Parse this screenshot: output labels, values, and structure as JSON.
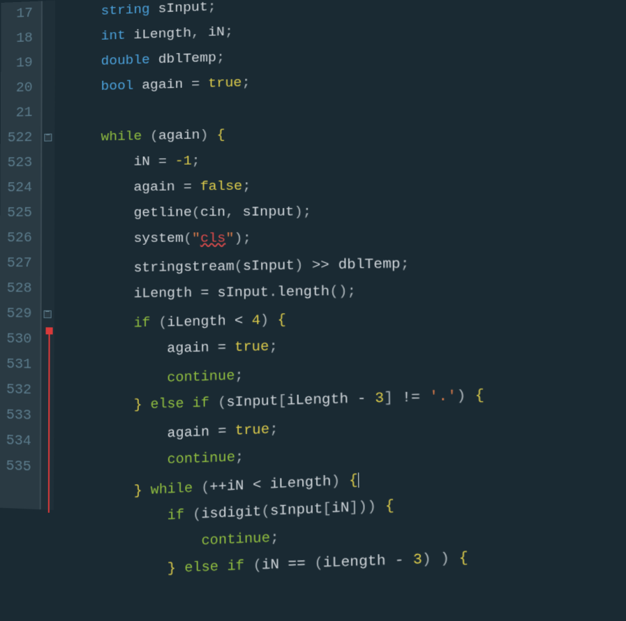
{
  "gutter": {
    "start": 16,
    "end": 535,
    "visible": [
      "17",
      "18",
      "19",
      "20",
      "21",
      "22",
      "23",
      "24",
      "25",
      "26",
      "27",
      "28",
      "29",
      "30",
      "31",
      "32",
      "33",
      "34",
      "35"
    ],
    "prefix_5": [
      "",
      "",
      "",
      "",
      "",
      "5",
      "5",
      "5",
      "5",
      "5",
      "5",
      "5",
      "5",
      "5",
      "5",
      "5",
      "5",
      "5",
      "5"
    ]
  },
  "fold": {
    "positions": [
      5,
      12
    ]
  },
  "code": {
    "lines": [
      {
        "indent": 2,
        "t": [
          [
            "type",
            "string"
          ],
          [
            "sp",
            " "
          ],
          [
            "ident",
            "sInput"
          ],
          [
            "punct",
            ";"
          ]
        ]
      },
      {
        "indent": 2,
        "t": [
          [
            "type",
            "int"
          ],
          [
            "sp",
            " "
          ],
          [
            "ident",
            "iLength"
          ],
          [
            "punct",
            ", "
          ],
          [
            "ident",
            "iN"
          ],
          [
            "punct",
            ";"
          ]
        ]
      },
      {
        "indent": 2,
        "t": [
          [
            "type",
            "double"
          ],
          [
            "sp",
            " "
          ],
          [
            "ident",
            "dblTemp"
          ],
          [
            "punct",
            ";"
          ]
        ]
      },
      {
        "indent": 2,
        "t": [
          [
            "type",
            "bool"
          ],
          [
            "sp",
            " "
          ],
          [
            "ident",
            "again"
          ],
          [
            "op",
            " = "
          ],
          [
            "bool",
            "true"
          ],
          [
            "punct",
            ";"
          ]
        ]
      },
      {
        "indent": 0,
        "t": []
      },
      {
        "indent": 2,
        "t": [
          [
            "kw",
            "while"
          ],
          [
            "sp",
            " "
          ],
          [
            "punct",
            "("
          ],
          [
            "ident",
            "again"
          ],
          [
            "punct",
            ") "
          ],
          [
            "bracket",
            "{"
          ]
        ]
      },
      {
        "indent": 4,
        "t": [
          [
            "ident",
            "iN"
          ],
          [
            "op",
            " = "
          ],
          [
            "num",
            "-1"
          ],
          [
            "punct",
            ";"
          ]
        ]
      },
      {
        "indent": 4,
        "t": [
          [
            "ident",
            "again"
          ],
          [
            "op",
            " = "
          ],
          [
            "bool",
            "false"
          ],
          [
            "punct",
            ";"
          ]
        ]
      },
      {
        "indent": 4,
        "t": [
          [
            "func",
            "getline"
          ],
          [
            "punct",
            "("
          ],
          [
            "ident",
            "cin"
          ],
          [
            "punct",
            ", "
          ],
          [
            "ident",
            "sInput"
          ],
          [
            "punct",
            ");"
          ]
        ]
      },
      {
        "indent": 4,
        "t": [
          [
            "func",
            "system"
          ],
          [
            "punct",
            "("
          ],
          [
            "str",
            "\""
          ],
          [
            "str-err",
            "cls"
          ],
          [
            "str",
            "\""
          ],
          [
            "punct",
            ");"
          ]
        ]
      },
      {
        "indent": 4,
        "t": [
          [
            "func",
            "stringstream"
          ],
          [
            "punct",
            "("
          ],
          [
            "ident",
            "sInput"
          ],
          [
            "punct",
            ") "
          ],
          [
            "op",
            ">> "
          ],
          [
            "ident",
            "dblTemp"
          ],
          [
            "punct",
            ";"
          ]
        ]
      },
      {
        "indent": 4,
        "t": [
          [
            "ident",
            "iLength"
          ],
          [
            "op",
            " = "
          ],
          [
            "ident",
            "sInput"
          ],
          [
            "punct",
            "."
          ],
          [
            "func",
            "length"
          ],
          [
            "punct",
            "();"
          ]
        ]
      },
      {
        "indent": 4,
        "t": [
          [
            "kw",
            "if"
          ],
          [
            "sp",
            " "
          ],
          [
            "punct",
            "("
          ],
          [
            "ident",
            "iLength"
          ],
          [
            "op",
            " < "
          ],
          [
            "num",
            "4"
          ],
          [
            "punct",
            ") "
          ],
          [
            "bracket",
            "{"
          ]
        ]
      },
      {
        "indent": 6,
        "t": [
          [
            "ident",
            "again"
          ],
          [
            "op",
            " = "
          ],
          [
            "bool",
            "true"
          ],
          [
            "punct",
            ";"
          ]
        ]
      },
      {
        "indent": 6,
        "t": [
          [
            "kw",
            "continue"
          ],
          [
            "punct",
            ";"
          ]
        ]
      },
      {
        "indent": 4,
        "t": [
          [
            "bracket",
            "}"
          ],
          [
            "sp",
            " "
          ],
          [
            "kw",
            "else if"
          ],
          [
            "sp",
            " "
          ],
          [
            "punct",
            "("
          ],
          [
            "ident",
            "sInput"
          ],
          [
            "punct",
            "["
          ],
          [
            "ident",
            "iLength"
          ],
          [
            "op",
            " - "
          ],
          [
            "num",
            "3"
          ],
          [
            "punct",
            "] "
          ],
          [
            "op",
            "!= "
          ],
          [
            "str",
            "'.'"
          ],
          [
            "punct",
            ") "
          ],
          [
            "bracket",
            "{"
          ]
        ]
      },
      {
        "indent": 6,
        "t": [
          [
            "ident",
            "again"
          ],
          [
            "op",
            " = "
          ],
          [
            "bool",
            "true"
          ],
          [
            "punct",
            ";"
          ]
        ]
      },
      {
        "indent": 6,
        "t": [
          [
            "kw",
            "continue"
          ],
          [
            "punct",
            ";"
          ]
        ]
      },
      {
        "indent": 4,
        "t": [
          [
            "bracket",
            "}"
          ],
          [
            "sp",
            " "
          ],
          [
            "kw",
            "while"
          ],
          [
            "sp",
            " "
          ],
          [
            "punct",
            "("
          ],
          [
            "op",
            "++"
          ],
          [
            "ident",
            "iN"
          ],
          [
            "op",
            " < "
          ],
          [
            "ident",
            "iLength"
          ],
          [
            "punct",
            ") "
          ],
          [
            "bracket",
            "{"
          ],
          [
            "caret",
            ""
          ]
        ]
      },
      {
        "indent": 6,
        "t": [
          [
            "kw",
            "if"
          ],
          [
            "sp",
            " "
          ],
          [
            "punct",
            "("
          ],
          [
            "func",
            "isdigit"
          ],
          [
            "punct",
            "("
          ],
          [
            "ident",
            "sInput"
          ],
          [
            "punct",
            "["
          ],
          [
            "ident",
            "iN"
          ],
          [
            "punct",
            "])) "
          ],
          [
            "bracket",
            "{"
          ]
        ]
      },
      {
        "indent": 8,
        "t": [
          [
            "kw",
            "continue"
          ],
          [
            "punct",
            ";"
          ]
        ]
      },
      {
        "indent": 6,
        "t": [
          [
            "bracket",
            "}"
          ],
          [
            "sp",
            " "
          ],
          [
            "kw",
            "else if"
          ],
          [
            "sp",
            " "
          ],
          [
            "punct",
            "("
          ],
          [
            "ident",
            "iN"
          ],
          [
            "op",
            " == "
          ],
          [
            "punct",
            "("
          ],
          [
            "ident",
            "iLength"
          ],
          [
            "op",
            " - "
          ],
          [
            "num",
            "3"
          ],
          [
            "punct",
            ") ) "
          ],
          [
            "bracket",
            "{"
          ]
        ]
      }
    ]
  }
}
